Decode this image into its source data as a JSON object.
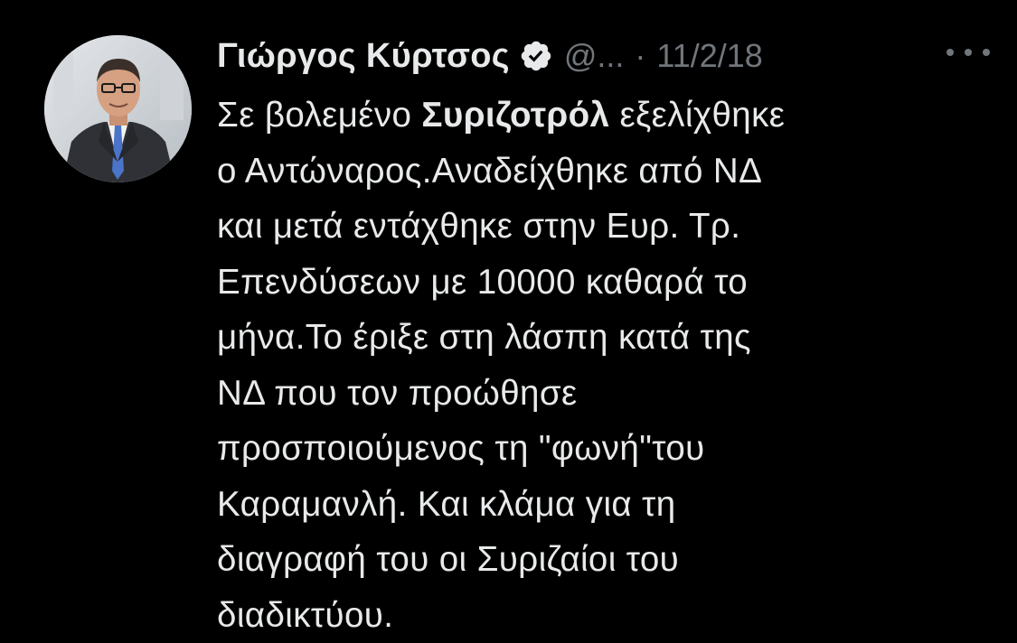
{
  "tweet": {
    "author_name": "Γιώργος Κύρτσος",
    "handle": "@...",
    "separator": "·",
    "date": "11/2/18",
    "verified_icon": "verified-badge-icon",
    "more_icon": "more-options-icon",
    "avatar_icon": "profile-photo",
    "lines": [
      {
        "pre": "Σε βολεμένο ",
        "bold": "Συριζοτρόλ",
        "post": " εξελίχθηκε"
      },
      {
        "pre": "ο Αντώναρος.Αναδείχθηκε από ΝΔ",
        "bold": "",
        "post": ""
      },
      {
        "pre": "και μετά εντάχθηκε στην Ευρ. Τρ.",
        "bold": "",
        "post": ""
      },
      {
        "pre": "Επενδύσεων με 10000 καθαρά το",
        "bold": "",
        "post": ""
      },
      {
        "pre": "μήνα.Το έριξε στη λάσπη κατά της",
        "bold": "",
        "post": ""
      },
      {
        "pre": "ΝΔ που τον προώθησε",
        "bold": "",
        "post": ""
      },
      {
        "pre": "προσποιούμενος τη \"φωνή\"του",
        "bold": "",
        "post": ""
      },
      {
        "pre": "Καραμανλή. Και κλάμα για τη",
        "bold": "",
        "post": ""
      },
      {
        "pre": "διαγραφή του οι Συριζαίοι του",
        "bold": "",
        "post": ""
      },
      {
        "pre": "διαδικτύου.",
        "bold": "",
        "post": ""
      }
    ]
  },
  "colors": {
    "background": "#000000",
    "primary_text": "#e7e9ea",
    "secondary_text": "#71767b"
  }
}
